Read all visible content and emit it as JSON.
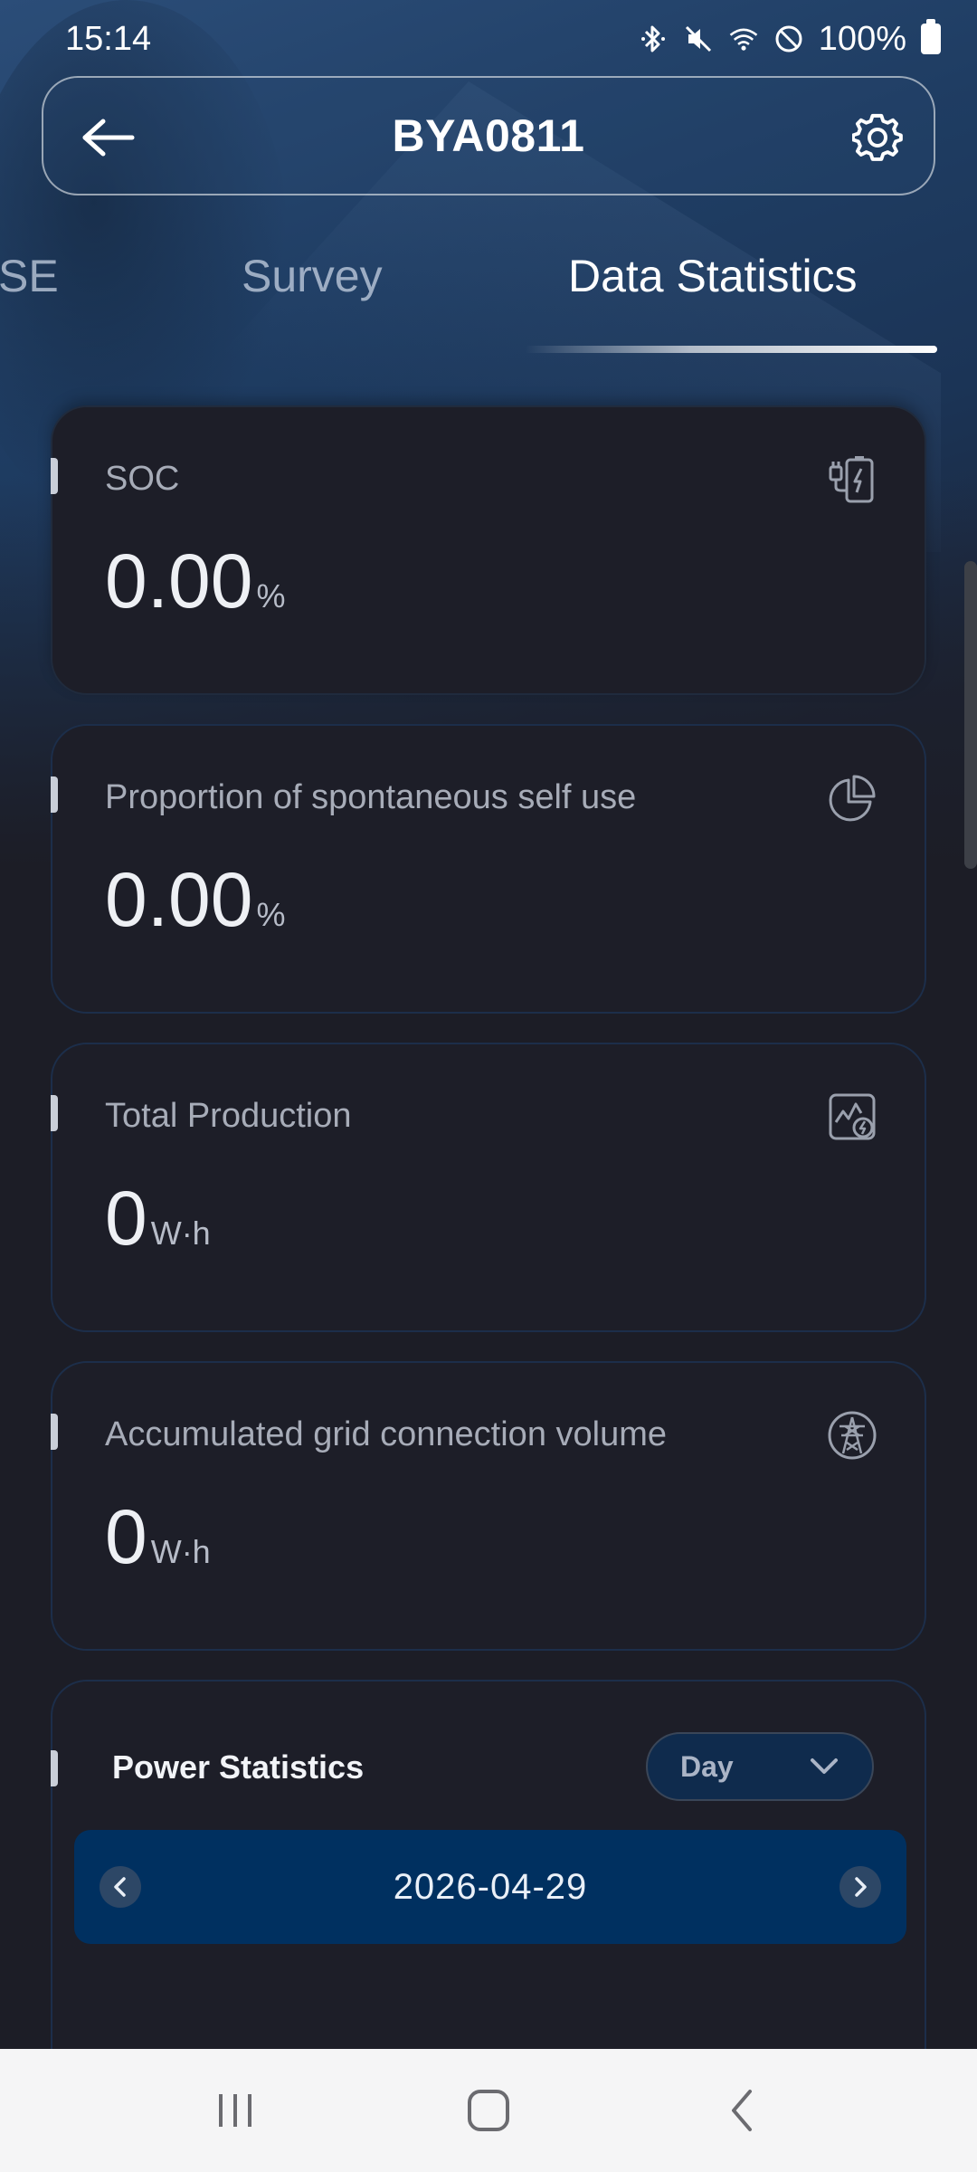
{
  "status_bar": {
    "time": "15:14",
    "battery_text": "100%",
    "icons": [
      "bluetooth-icon",
      "mute-icon",
      "wifi-icon",
      "do-not-disturb-icon",
      "battery-icon"
    ]
  },
  "header": {
    "title": "BYA0811",
    "back_icon": "arrow-left-icon",
    "settings_icon": "gear-icon"
  },
  "tabs": [
    {
      "label": "SE",
      "active": false
    },
    {
      "label": "Survey",
      "active": false
    },
    {
      "label": "Data Statistics",
      "active": true
    }
  ],
  "cards": [
    {
      "label": "SOC",
      "value": "0.00",
      "unit": "%",
      "icon": "battery-charge-icon"
    },
    {
      "label": "Proportion of spontaneous self use",
      "value": "0.00",
      "unit": "%",
      "icon": "pie-chart-icon"
    },
    {
      "label": "Total Production",
      "value": "0",
      "unit": "W·h",
      "icon": "production-chart-icon"
    },
    {
      "label": "Accumulated grid connection volume",
      "value": "0",
      "unit": "W·h",
      "icon": "power-tower-icon"
    }
  ],
  "power_statistics": {
    "title": "Power Statistics",
    "period": "Day",
    "date": "2026-04-29"
  },
  "nav_bar": {
    "icons": [
      "recent-apps-icon",
      "home-icon",
      "back-icon"
    ]
  },
  "colors": {
    "background": "#1c1d26",
    "card_border": "#1c2e4a",
    "date_bar": "#003060",
    "select_bg": "#0f2b4d"
  }
}
